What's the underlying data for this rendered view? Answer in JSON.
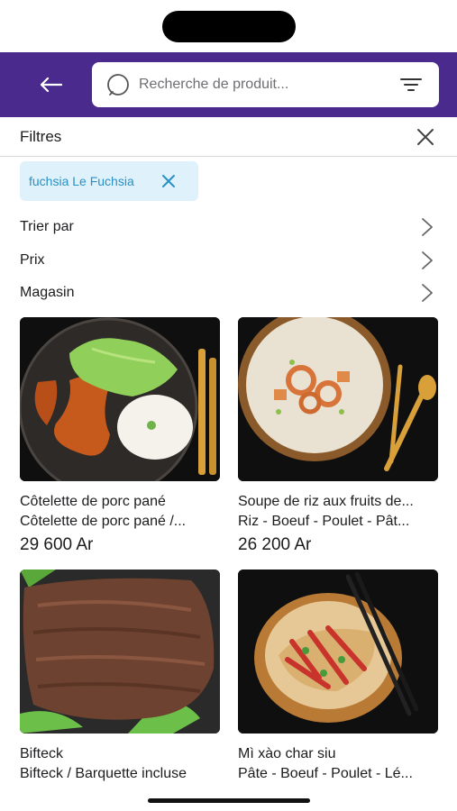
{
  "search": {
    "placeholder": "Recherche de produit..."
  },
  "filters": {
    "title": "Filtres",
    "active_chip": "fuchsia Le Fuchsia",
    "options": [
      {
        "label": "Trier par"
      },
      {
        "label": "Prix"
      },
      {
        "label": "Magasin"
      }
    ]
  },
  "products": [
    {
      "title": "Côtelette de porc pané",
      "subtitle": "Côtelette de porc pané  /...",
      "price": "29 600 Ar"
    },
    {
      "title": "Soupe de riz aux fruits de...",
      "subtitle": "Riz - Boeuf - Poulet - Pât...",
      "price": "26 200 Ar"
    },
    {
      "title": "Bifteck",
      "subtitle": "Bifteck / Barquette incluse",
      "price": ""
    },
    {
      "title": "Mì xào char siu",
      "subtitle": "Pâte - Boeuf - Poulet - Lé...",
      "price": ""
    }
  ],
  "colors": {
    "header_bg": "#4a2a8c",
    "chip_bg": "#dff2fb",
    "chip_text": "#2a8fc4"
  },
  "icons": [
    "back-arrow-icon",
    "search-icon",
    "filter-icon",
    "close-icon",
    "chip-remove-icon",
    "chevron-right-icon"
  ]
}
